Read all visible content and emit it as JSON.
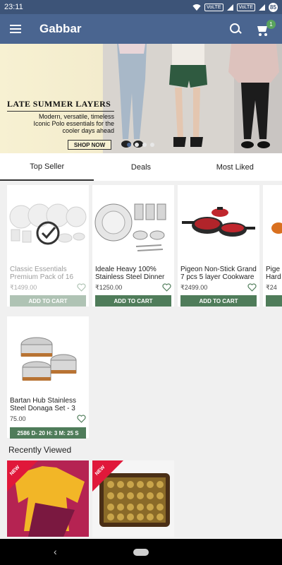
{
  "status_bar": {
    "time": "23:11",
    "volte1": "VoLTE",
    "volte2": "VoLTE",
    "battery": "85"
  },
  "app_bar": {
    "title": "Gabbar",
    "cart_count": "1"
  },
  "banner": {
    "title": "LATE SUMMER LAYERS",
    "subtitle_line1": "Modern, versatile, timeless",
    "subtitle_line2": "Iconic Polo essentials for the",
    "subtitle_line3": "cooler days ahead",
    "button": "SHOP NOW",
    "slide_count": 4,
    "active_slide": 1
  },
  "tabs": [
    {
      "label": "Top Seller",
      "active": true
    },
    {
      "label": "Deals",
      "active": false
    },
    {
      "label": "Most Liked",
      "active": false
    }
  ],
  "products": [
    {
      "name": "Classic Essentials Premium Pack of 16",
      "price": "₹1499.00",
      "button": "ADD TO CART",
      "faded": true
    },
    {
      "name": "Ideale Heavy 100% Stainless Steel Dinner Set",
      "price": "₹1250.00",
      "button": "ADD TO CART",
      "faded": false
    },
    {
      "name": "Pigeon Non-Stick Grand 7 pcs 5 layer Cookware Set",
      "price": "₹2499.00",
      "button": "ADD TO CART",
      "faded": false
    },
    {
      "name": "Pige Hard",
      "price": "₹24",
      "button": "",
      "faded": false
    },
    {
      "name": "Bartan Hub Stainless Steel Donaga Set - 3",
      "price": "75.00",
      "timer": "2586 D- 20 H: 3 M: 25 S"
    }
  ],
  "recently_viewed": {
    "title": "Recently Viewed",
    "badge": "NEW"
  },
  "colors": {
    "primary": "#4a6590",
    "status_bar": "#3d5478",
    "accent_green": "#4f7c5a",
    "badge_red": "#e0183a"
  }
}
